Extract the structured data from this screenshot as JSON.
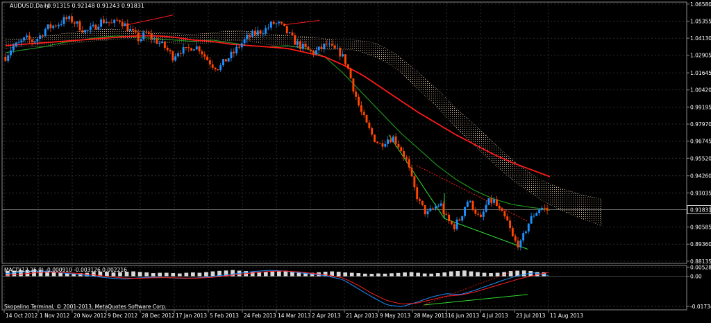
{
  "chart_header": {
    "symbol": "AUDUSD,Daily",
    "ohlc": "0.91315 0.92148 0.91243 0.91831"
  },
  "macd_header": {
    "label": "MACD(12,26,9) -0.000910 -0.003126 0.002216"
  },
  "copyright": "Skopalino Terminal, © 2001-2013, MetaQuotes Software Corp.",
  "colors": {
    "background": "#000000",
    "grid": "#3a3a3a",
    "bull": "#1e90ff",
    "bear": "#ff4500",
    "ma_red": "#ff1a1a",
    "ma_green": "#1f8f1f",
    "cloud": "#d9c0a0",
    "trend_green": "#33dd33",
    "macd_hist": "#d8d8d8",
    "macd_signal": "#ff2020",
    "macd_line": "#1e90ff",
    "axis_text": "#ffffff"
  },
  "chart_data": [
    {
      "type": "candlestick",
      "title": "AUDUSD,Daily",
      "x_tick_labels": [
        "14 Oct 2012",
        "1 Nov 2012",
        "20 Nov 2012",
        "9 Dec 2012",
        "28 Dec 2012",
        "17 Jan 2013",
        "5 Feb 2013",
        "24 Feb 2013",
        "14 Mar 2013",
        "2 Apr 2013",
        "21 Apr 2013",
        "9 May 2013",
        "28 May 2013",
        "16 Jun 2013",
        "4 Jul 2013",
        "23 Jul 2013",
        "11 Aug 2013"
      ],
      "y_tick_labels": [
        "1.06580",
        "1.05355",
        "1.04130",
        "1.02905",
        "1.01645",
        "1.00420",
        "0.99195",
        "0.97970",
        "0.96745",
        "0.95520",
        "0.94260",
        "0.93035",
        "0.91831",
        "0.90585",
        "0.89360",
        "0.88135"
      ],
      "ylim": [
        0.8798,
        1.0672
      ],
      "current_price": 0.91831,
      "grid": true,
      "closes_anchor": [
        1.028,
        1.035,
        1.037,
        1.041,
        1.039,
        1.042,
        1.048,
        1.05,
        1.052,
        1.055,
        1.054,
        1.05,
        1.046,
        1.048,
        1.053,
        1.054,
        1.051,
        1.055,
        1.05,
        1.045,
        1.04,
        1.045,
        1.041,
        1.038,
        1.034,
        1.028,
        1.033,
        1.032,
        1.036,
        1.034,
        1.027,
        1.022,
        1.02,
        1.026,
        1.03,
        1.036,
        1.041,
        1.044,
        1.046,
        1.048,
        1.052,
        1.051,
        1.046,
        1.04,
        1.036,
        1.033,
        1.031,
        1.033,
        1.037,
        1.033,
        1.031,
        1.023,
        1.006,
        0.99,
        0.979,
        0.97,
        0.965,
        0.969,
        0.97,
        0.963,
        0.953,
        0.935,
        0.922,
        0.915,
        0.919,
        0.923,
        0.911,
        0.906,
        0.912,
        0.925,
        0.92,
        0.91,
        0.923,
        0.925,
        0.916,
        0.91,
        0.896,
        0.893,
        0.907,
        0.915,
        0.92,
        0.918
      ],
      "ma_red": [
        1.036,
        1.037,
        1.038,
        1.039,
        1.04,
        1.041,
        1.042,
        1.043,
        1.043,
        1.042,
        1.04,
        1.039,
        1.037,
        1.036,
        1.035,
        1.034,
        1.031,
        1.028,
        1.022,
        1.015,
        1.006,
        0.997,
        0.988,
        0.98,
        0.972,
        0.965,
        0.958,
        0.952,
        0.947,
        0.942
      ],
      "ma_green": [
        1.031,
        1.033,
        1.035,
        1.038,
        1.04,
        1.042,
        1.043,
        1.042,
        1.041,
        1.04,
        1.039,
        1.04,
        1.038,
        1.036,
        1.035,
        1.036,
        1.034,
        1.028,
        1.016,
        1.002,
        0.988,
        0.974,
        0.962,
        0.95,
        0.94,
        0.932,
        0.926,
        0.922,
        0.92,
        0.918
      ],
      "cloud_upper": [
        1.04,
        1.041,
        1.043,
        1.045,
        1.047,
        1.048,
        1.047,
        1.046,
        1.045,
        1.044,
        1.045,
        1.047,
        1.046,
        1.044,
        1.043,
        1.042,
        1.04,
        1.04,
        1.038,
        1.03,
        1.018,
        1.005,
        0.99,
        0.977,
        0.963,
        0.95,
        0.94,
        0.934,
        0.929,
        0.926
      ],
      "cloud_lower": [
        1.034,
        1.036,
        1.035,
        1.037,
        1.039,
        1.04,
        1.041,
        1.039,
        1.038,
        1.037,
        1.038,
        1.04,
        1.039,
        1.036,
        1.035,
        1.034,
        1.033,
        1.033,
        1.028,
        1.02,
        1.006,
        0.992,
        0.976,
        0.962,
        0.948,
        0.936,
        0.926,
        0.918,
        0.912,
        0.907
      ]
    },
    {
      "type": "bar",
      "title": "MACD(12,26,9) -0.000910 -0.003126 0.002216",
      "y_tick_labels": [
        "0.005285",
        "0.00",
        "-0.01734"
      ],
      "ylim": [
        -0.0193,
        0.0062
      ],
      "histogram": [
        0.003,
        0.0032,
        0.0035,
        0.0036,
        0.0037,
        0.0034,
        0.003,
        0.0024,
        0.002,
        0.0018,
        0.0015,
        0.0018,
        0.002,
        0.0025,
        0.0027,
        0.0026,
        0.0022,
        0.0024,
        0.0026,
        0.0028,
        0.0025,
        0.0022,
        0.0018,
        0.002,
        0.002,
        0.0018,
        0.0016,
        0.002,
        0.0022,
        0.002,
        0.0024,
        0.0028,
        0.0031,
        0.0033,
        0.0036,
        0.0032,
        0.003,
        0.0027,
        0.0025,
        0.0026,
        0.0028,
        0.003,
        0.0032,
        0.0028,
        0.0025,
        0.0022,
        0.002,
        0.0023,
        0.0026,
        0.0028,
        0.0026,
        0.0022,
        0.002,
        0.0018,
        0.0015,
        0.0014,
        0.0016,
        0.0015,
        0.0017,
        0.0019,
        0.0022,
        0.0024,
        0.002,
        0.0016,
        0.0015,
        0.0018,
        0.0022,
        0.0028,
        0.003,
        0.0033,
        0.0028,
        0.0024,
        0.002,
        0.0018,
        0.002,
        0.0024,
        0.003,
        0.0032,
        0.0033,
        0.003,
        0.0024,
        0.0022
      ],
      "macd_line": [
        0.0015,
        0.0022,
        0.003,
        0.0028,
        0.0018,
        0.001,
        0.0,
        -0.001,
        -0.0016,
        -0.001,
        -0.0005,
        -0.0008,
        -0.0012,
        -0.001,
        -0.0002,
        0.0008,
        0.0018,
        0.0028,
        0.0034,
        0.003,
        0.002,
        0.0012,
        0.0,
        -0.002,
        -0.007,
        -0.012,
        -0.0165,
        -0.0175,
        -0.015,
        -0.012,
        -0.01,
        -0.0105,
        -0.008,
        -0.005,
        -0.002,
        0.0005,
        0.002,
        0.0004
      ],
      "signal_line": [
        0.0005,
        0.0012,
        0.002,
        0.0024,
        0.0022,
        0.0016,
        0.0008,
        -0.0002,
        -0.001,
        -0.0012,
        -0.0009,
        -0.0008,
        -0.001,
        -0.0011,
        -0.0007,
        0.0002,
        0.0012,
        0.002,
        0.0028,
        0.003,
        0.0025,
        0.0016,
        0.0006,
        -0.001,
        -0.005,
        -0.01,
        -0.014,
        -0.016,
        -0.0155,
        -0.0135,
        -0.0115,
        -0.0108,
        -0.009,
        -0.0065,
        -0.004,
        -0.0015,
        0.0005,
        0.0022
      ]
    }
  ]
}
